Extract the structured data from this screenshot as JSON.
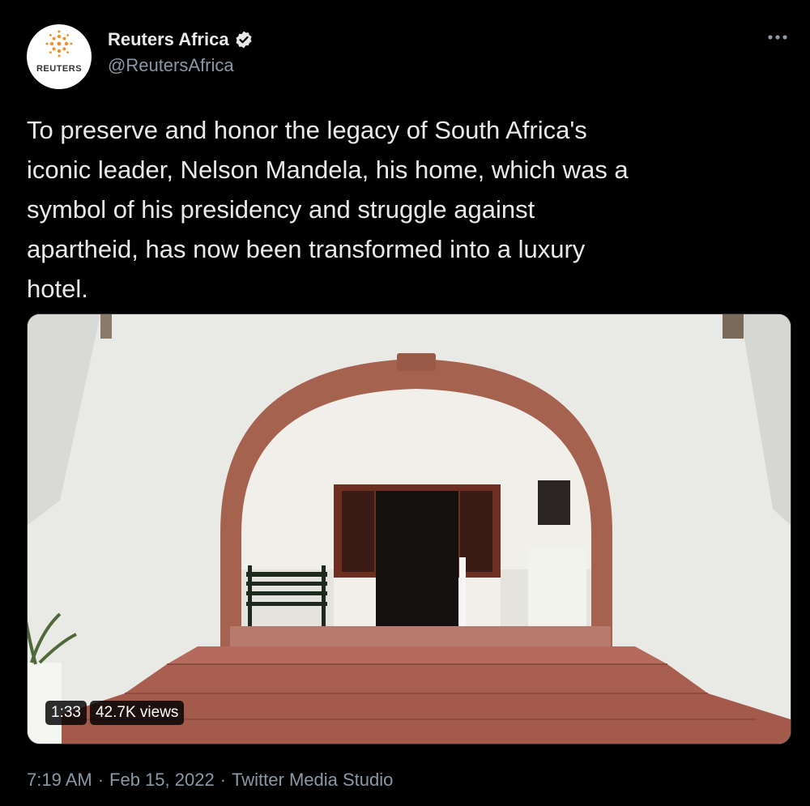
{
  "author": {
    "display_name": "Reuters Africa",
    "handle": "@ReutersAfrica",
    "avatar_label": "REUTERS",
    "verified": true
  },
  "tweet": {
    "text": "To preserve and honor the legacy of South Africa's\niconic leader, Nelson Mandela, his home, which was a\nsymbol of his presidency and struggle against\napartheid, has now been transformed into a luxury\nhotel."
  },
  "video": {
    "duration": "1:33",
    "views": "42.7K views"
  },
  "meta": {
    "time": "7:19 AM",
    "separator": "·",
    "date": "Feb 15, 2022",
    "source": "Twitter Media Studio"
  },
  "colors": {
    "background": "#000000",
    "text": "#e7e9ea",
    "secondary": "#8b98a5",
    "brick": "#a5624f",
    "reuters_orange": "#f28c28"
  },
  "icons": {
    "verified": "verified-badge-icon",
    "more": "more-options-icon"
  }
}
